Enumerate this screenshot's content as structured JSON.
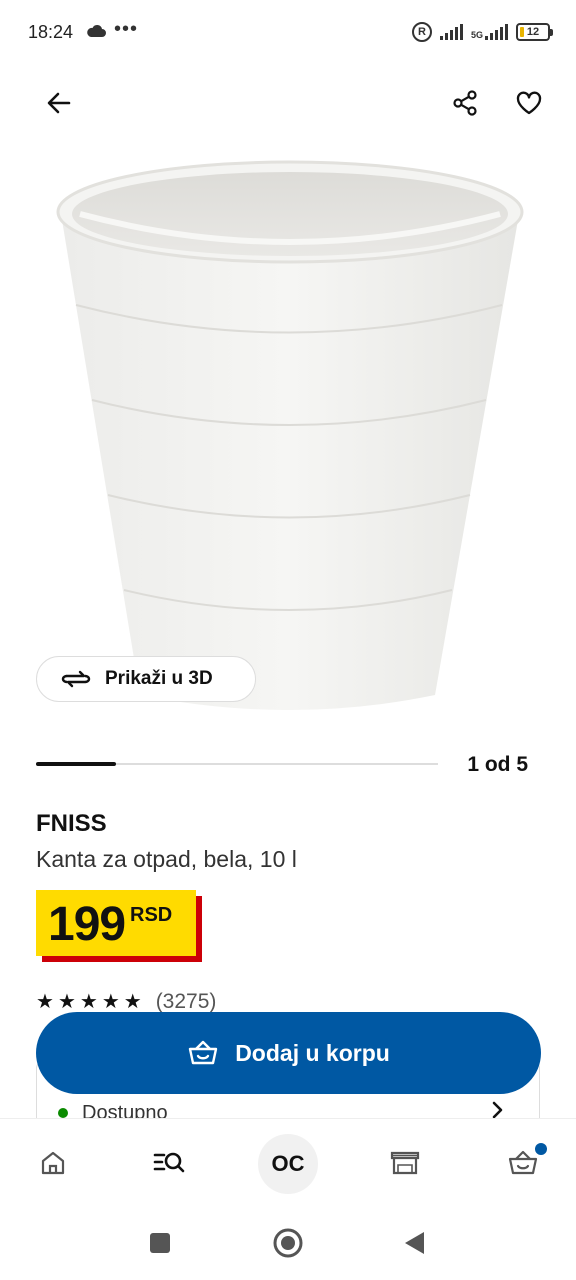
{
  "status_bar": {
    "time": "18:24",
    "dots": "•••",
    "network": "5G",
    "battery": "12"
  },
  "header": {
    "back_icon": "arrow-left-icon",
    "share_icon": "share-icon",
    "favorite_icon": "heart-icon"
  },
  "gallery": {
    "view_3d_label": "Prikaži u 3D",
    "counter": "1 od 5",
    "progress": 0.2
  },
  "product": {
    "name": "FNISS",
    "description": "Kanta za otpad, bela, 10 l",
    "price": "199",
    "currency": "RSD",
    "rating": 5,
    "review_count": "(3275)"
  },
  "cta": {
    "add_to_cart_label": "Dodaj u korpu"
  },
  "availability": {
    "label": "Dostupno"
  },
  "bottom_nav": {
    "center_label": "OC",
    "items": [
      "home-icon",
      "search-icon",
      "profile",
      "store-icon",
      "cart-icon"
    ]
  },
  "colors": {
    "brand_blue": "#0058a3",
    "price_yellow": "#ffdb00",
    "price_red": "#cc0008",
    "available_green": "#0a8a00"
  }
}
